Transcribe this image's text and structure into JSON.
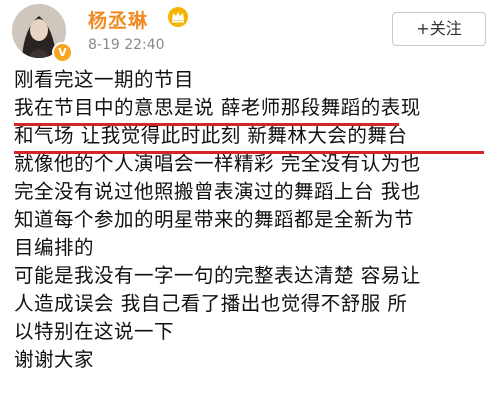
{
  "header": {
    "username": "杨丞琳",
    "timestamp": "8-19 22:40",
    "follow_label": "+关注",
    "verified_badge": "V",
    "icons": {
      "avatar": "avatar-photo",
      "verified": "verified-badge-icon",
      "crown": "crown-icon"
    }
  },
  "post": {
    "lines": [
      "刚看完这一期的节目",
      "我在节目中的意思是说 薛老师那段舞蹈的表现",
      "和气场 让我觉得此时此刻 新舞林大会的舞台",
      "就像他的个人演唱会一样精彩 完全没有认为也",
      "完全没有说过他照搬曾表演过的舞蹈上台 我也",
      "知道每个参加的明星带来的舞蹈都是全新为节",
      "目编排的",
      "可能是我没有一字一句的完整表达清楚 容易让",
      "人造成误会 我自己看了播出也觉得不舒服 所",
      "以特别在这说一下",
      "谢谢大家"
    ]
  },
  "colors": {
    "username": "#f08a24",
    "underline": "#d2262b",
    "verified": "#f5a623"
  }
}
